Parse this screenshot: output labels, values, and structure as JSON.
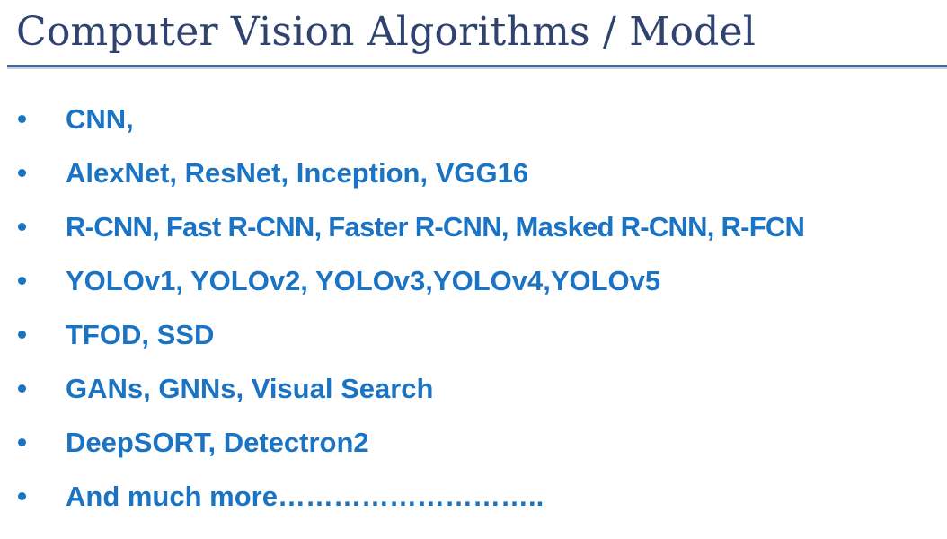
{
  "slide": {
    "title": "Computer Vision Algorithms / Model",
    "colors": {
      "title_text": "#2f4270",
      "title_rule": "#4b669a",
      "bullet_text": "#1a73c3",
      "bullet_marker": "#1a73c3",
      "background": "#ffffff"
    },
    "bullets": [
      {
        "marker": "•",
        "text": "CNN,"
      },
      {
        "marker": "•",
        "text": "AlexNet, ResNet, Inception, VGG16"
      },
      {
        "marker": "•",
        "text": "R-CNN, Fast R-CNN, Faster R-CNN, Masked R-CNN, R-FCN"
      },
      {
        "marker": "•",
        "text": "YOLOv1, YOLOv2, YOLOv3,YOLOv4,YOLOv5"
      },
      {
        "marker": "•",
        "text": "TFOD, SSD"
      },
      {
        "marker": "•",
        "text": "GANs, GNNs, Visual Search"
      },
      {
        "marker": "•",
        "text": "DeepSORT, Detectron2"
      },
      {
        "marker": "•",
        "text": "And much more……………………….."
      }
    ]
  }
}
